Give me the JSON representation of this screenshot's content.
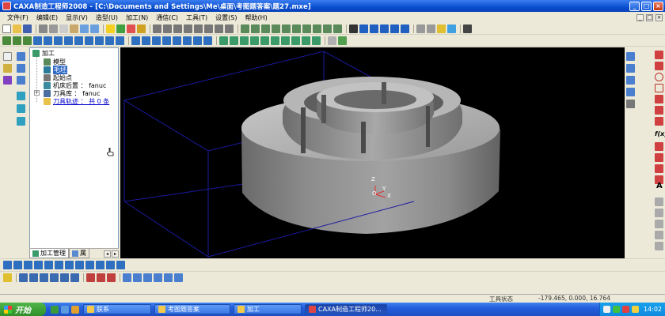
{
  "window": {
    "title": "CAXA制造工程师2008  - [C:\\Documents and Settings\\Me\\桌面\\考图题答案\\题27.mxe]"
  },
  "menu": {
    "items": [
      "文件(F)",
      "编辑(E)",
      "显示(V)",
      "造型(U)",
      "加工(N)",
      "通信(C)",
      "工具(T)",
      "设置(S)",
      "帮助(H)"
    ]
  },
  "tree": {
    "root": "加工",
    "items": [
      {
        "label": "模型"
      },
      {
        "label": "毛坯"
      },
      {
        "label": "起始点"
      },
      {
        "label": "机床后置 ： fanuc"
      },
      {
        "label": "刀具库 ： fanuc"
      },
      {
        "label": "刀具轨迹 ： 共 0 条"
      }
    ],
    "tabs": [
      "加工管理",
      "属"
    ]
  },
  "viewport": {
    "axis_z": "Z",
    "axis_y": "Y",
    "axis_x": "X",
    "axis_o": "O"
  },
  "statusbar": {
    "tool_state": "工具状态",
    "coords": "-179.465, 0.000, 16.764"
  },
  "taskbar": {
    "start": "开始",
    "tasks": [
      {
        "label": "肤系"
      },
      {
        "label": "考图题答案"
      },
      {
        "label": "加工"
      },
      {
        "label": "CAXA制造工程师20..."
      }
    ],
    "clock": "14:02"
  },
  "colors": {
    "title_bar": "#0a4fd0",
    "viewport_bg": "#000000",
    "stock_box": "#1a1aa0",
    "part_gray": "#8a8a8a",
    "selection": "#316ac5"
  }
}
